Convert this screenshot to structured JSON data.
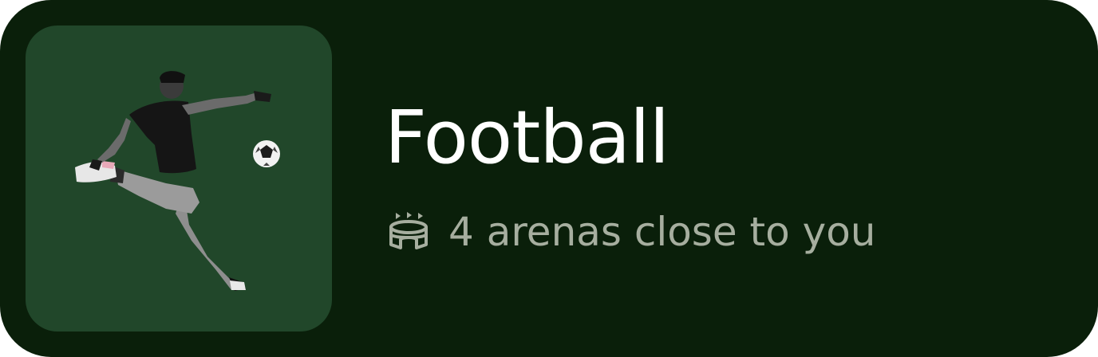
{
  "card": {
    "title": "Football",
    "subtitle": "4 arenas close to you",
    "icon": "stadium-icon",
    "image": "football-player-kicking-ball",
    "colors": {
      "background": "#0a1f0a",
      "thumbnail": "#21472a",
      "title": "#ffffff",
      "subtitle": "#a6ae9f"
    }
  }
}
